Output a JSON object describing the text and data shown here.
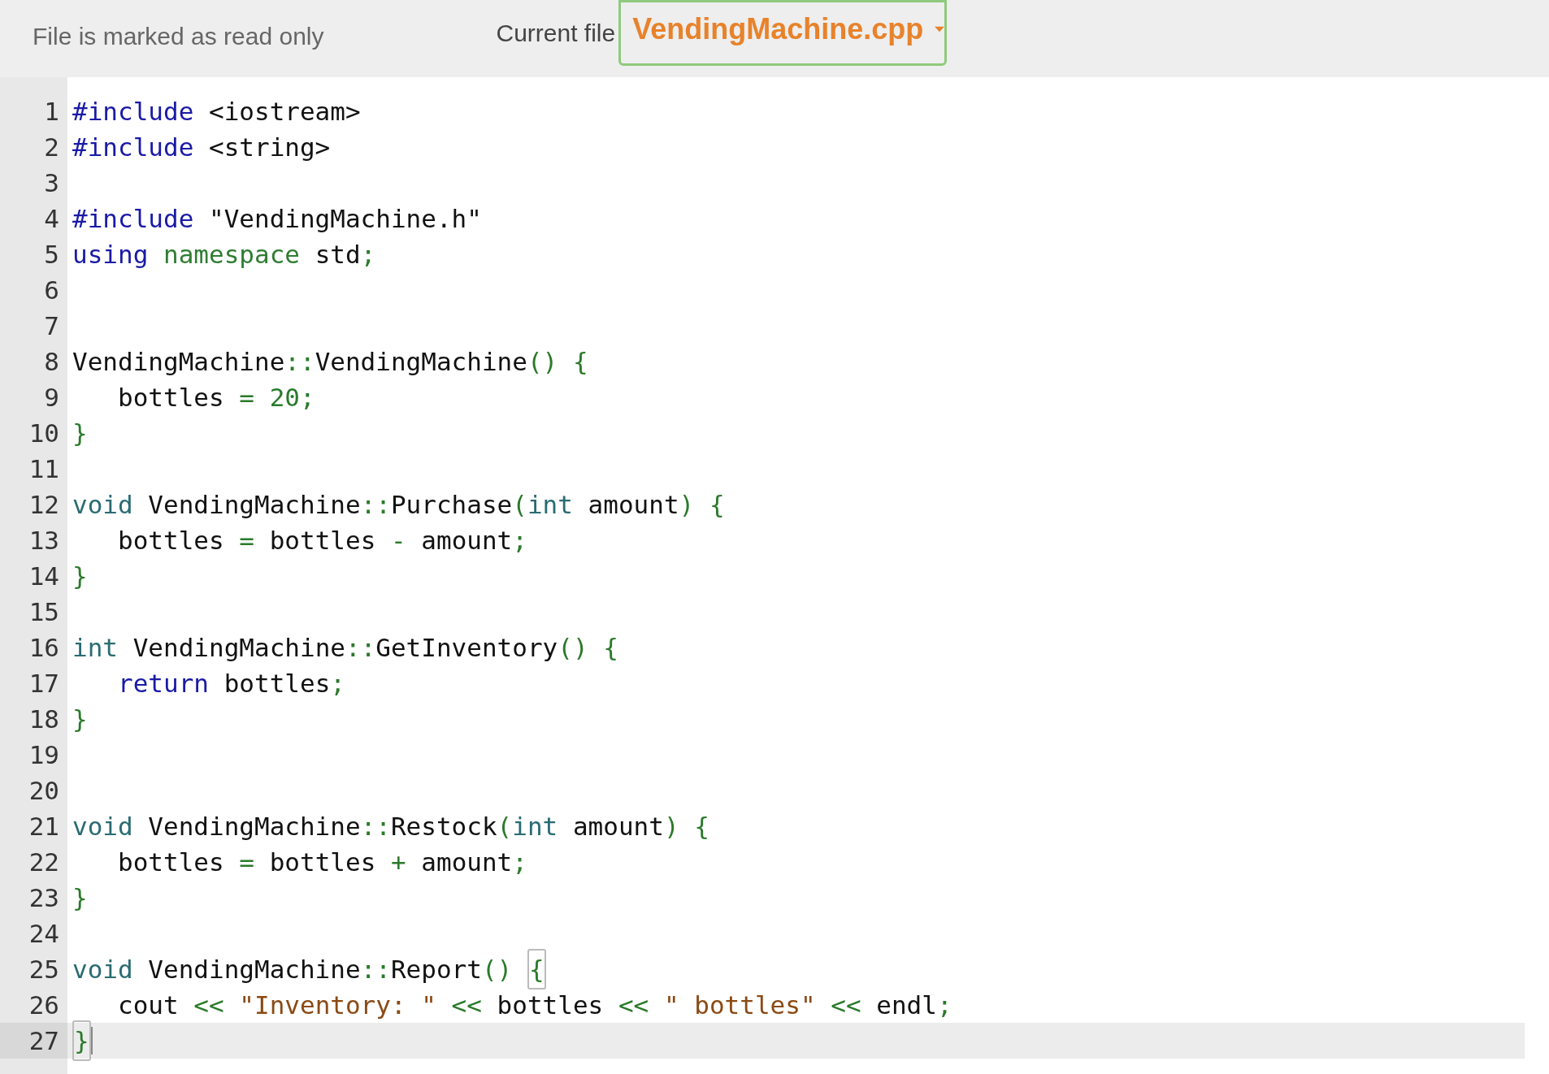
{
  "header": {
    "status": "File is marked as read only",
    "file_label": "Current file",
    "file_select": {
      "value": "VendingMachine.cpp"
    }
  },
  "editor": {
    "lines": [
      {
        "number": "1",
        "active": false,
        "tokens": [
          {
            "text": "#include",
            "kind": "keyword"
          },
          {
            "text": " <iostream>",
            "kind": "plain"
          }
        ]
      },
      {
        "number": "2",
        "active": false,
        "tokens": [
          {
            "text": "#include",
            "kind": "keyword"
          },
          {
            "text": " <string>",
            "kind": "plain"
          }
        ]
      },
      {
        "number": "3",
        "active": false
      },
      {
        "number": "4",
        "active": false,
        "tokens": [
          {
            "text": "#include",
            "kind": "keyword"
          },
          {
            "text": " \"VendingMachine.h\"",
            "kind": "plain"
          }
        ]
      },
      {
        "number": "5",
        "active": false,
        "tokens": [
          {
            "text": "using",
            "kind": "keyword"
          },
          {
            "text": " namespace",
            "kind": "builtin"
          },
          {
            "text": " std",
            "kind": "plain"
          },
          {
            "text": ";",
            "kind": "punct"
          }
        ]
      },
      {
        "number": "6",
        "active": false
      },
      {
        "number": "7",
        "active": false
      },
      {
        "number": "8",
        "active": false,
        "tokens": [
          {
            "text": "VendingMachine",
            "kind": "plain"
          },
          {
            "text": "::",
            "kind": "punct"
          },
          {
            "text": "VendingMachine",
            "kind": "plain"
          },
          {
            "text": "() {",
            "kind": "punct"
          }
        ]
      },
      {
        "number": "9",
        "active": false,
        "tokens": [
          {
            "text": "   bottles ",
            "kind": "plain"
          },
          {
            "text": "= 20;",
            "kind": "punct"
          }
        ]
      },
      {
        "number": "10",
        "active": false,
        "tokens": [
          {
            "text": "}",
            "kind": "punct"
          }
        ]
      },
      {
        "number": "11",
        "active": false
      },
      {
        "number": "12",
        "active": false,
        "tokens": [
          {
            "text": "void",
            "kind": "type"
          },
          {
            "text": " VendingMachine",
            "kind": "plain"
          },
          {
            "text": "::",
            "kind": "punct"
          },
          {
            "text": "Purchase",
            "kind": "plain"
          },
          {
            "text": "(",
            "kind": "punct"
          },
          {
            "text": "int",
            "kind": "type"
          },
          {
            "text": " amount",
            "kind": "plain"
          },
          {
            "text": ") {",
            "kind": "punct"
          }
        ]
      },
      {
        "number": "13",
        "active": false,
        "tokens": [
          {
            "text": "   bottles ",
            "kind": "plain"
          },
          {
            "text": "=",
            "kind": "punct"
          },
          {
            "text": " bottles ",
            "kind": "plain"
          },
          {
            "text": "-",
            "kind": "punct"
          },
          {
            "text": " amount",
            "kind": "plain"
          },
          {
            "text": ";",
            "kind": "punct"
          }
        ]
      },
      {
        "number": "14",
        "active": false,
        "tokens": [
          {
            "text": "}",
            "kind": "punct"
          }
        ]
      },
      {
        "number": "15",
        "active": false
      },
      {
        "number": "16",
        "active": false,
        "tokens": [
          {
            "text": "int",
            "kind": "type"
          },
          {
            "text": " VendingMachine",
            "kind": "plain"
          },
          {
            "text": "::",
            "kind": "punct"
          },
          {
            "text": "GetInventory",
            "kind": "plain"
          },
          {
            "text": "() {",
            "kind": "punct"
          }
        ]
      },
      {
        "number": "17",
        "active": false,
        "tokens": [
          {
            "text": "   return",
            "kind": "keyword"
          },
          {
            "text": " bottles",
            "kind": "plain"
          },
          {
            "text": ";",
            "kind": "punct"
          }
        ]
      },
      {
        "number": "18",
        "active": false,
        "tokens": [
          {
            "text": "}",
            "kind": "punct"
          }
        ]
      },
      {
        "number": "19",
        "active": false
      },
      {
        "number": "20",
        "active": false
      },
      {
        "number": "21",
        "active": false,
        "tokens": [
          {
            "text": "void",
            "kind": "type"
          },
          {
            "text": " VendingMachine",
            "kind": "plain"
          },
          {
            "text": "::",
            "kind": "punct"
          },
          {
            "text": "Restock",
            "kind": "plain"
          },
          {
            "text": "(",
            "kind": "punct"
          },
          {
            "text": "int",
            "kind": "type"
          },
          {
            "text": " amount",
            "kind": "plain"
          },
          {
            "text": ") {",
            "kind": "punct"
          }
        ]
      },
      {
        "number": "22",
        "active": false,
        "tokens": [
          {
            "text": "   bottles ",
            "kind": "plain"
          },
          {
            "text": "=",
            "kind": "punct"
          },
          {
            "text": " bottles ",
            "kind": "plain"
          },
          {
            "text": "+",
            "kind": "punct"
          },
          {
            "text": " amount",
            "kind": "plain"
          },
          {
            "text": ";",
            "kind": "punct"
          }
        ]
      },
      {
        "number": "23",
        "active": false,
        "tokens": [
          {
            "text": "}",
            "kind": "punct"
          }
        ]
      },
      {
        "number": "24",
        "active": false
      },
      {
        "number": "25",
        "active": false,
        "tokens": [
          {
            "text": "void",
            "kind": "type"
          },
          {
            "text": " VendingMachine",
            "kind": "plain"
          },
          {
            "text": "::",
            "kind": "punct"
          },
          {
            "text": "Report",
            "kind": "plain"
          },
          {
            "text": "() ",
            "kind": "punct"
          },
          {
            "text": "{",
            "kind": "punct",
            "matched": true
          }
        ]
      },
      {
        "number": "26",
        "active": false,
        "tokens": [
          {
            "text": "   cout ",
            "kind": "plain"
          },
          {
            "text": "<< ",
            "kind": "punct"
          },
          {
            "text": "\"Inventory: \"",
            "kind": "string"
          },
          {
            "text": " <<",
            "kind": "punct"
          },
          {
            "text": " bottles ",
            "kind": "plain"
          },
          {
            "text": "<< ",
            "kind": "punct"
          },
          {
            "text": "\" bottles\"",
            "kind": "string"
          },
          {
            "text": " <<",
            "kind": "punct"
          },
          {
            "text": " endl",
            "kind": "plain"
          },
          {
            "text": ";",
            "kind": "punct"
          }
        ]
      },
      {
        "number": "27",
        "active": true,
        "tokens": [
          {
            "text": "}",
            "kind": "punct",
            "matched": true
          }
        ]
      }
    ]
  }
}
